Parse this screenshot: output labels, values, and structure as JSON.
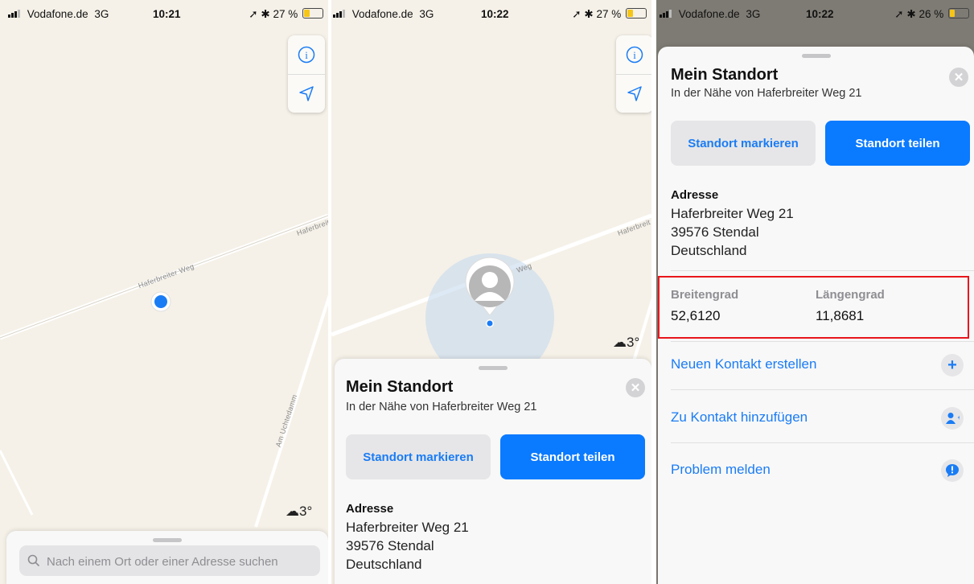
{
  "panels": [
    {
      "status": {
        "carrier": "Vodafone.de",
        "network": "3G",
        "time": "10:21",
        "battery": "27 %"
      }
    },
    {
      "status": {
        "carrier": "Vodafone.de",
        "network": "3G",
        "time": "10:22",
        "battery": "27 %"
      }
    },
    {
      "status": {
        "carrier": "Vodafone.de",
        "network": "3G",
        "time": "10:22",
        "battery": "26 %"
      }
    }
  ],
  "map": {
    "road_haferbreiter_weg": "Haferbreiter Weg",
    "road_haferbreit_cut": "Haferbreit",
    "road_am_uchtedamm": "Am Uchtedamm",
    "road_weg_fragment": "Weg",
    "weather": "3°",
    "info_icon": "info-icon",
    "location_icon": "location-arrow-icon"
  },
  "search": {
    "placeholder": "Nach einem Ort oder einer Adresse suchen"
  },
  "place_card": {
    "title": "Mein Standort",
    "subtitle": "In der Nähe von Haferbreiter Weg 21",
    "mark_button": "Standort markieren",
    "share_button": "Standort teilen",
    "address_label": "Adresse",
    "address_line1": "Haferbreiter Weg 21",
    "address_line2": "39576 Stendal",
    "address_line3": "Deutschland",
    "lat_label": "Breitengrad",
    "lat_value": "52,6120",
    "lon_label": "Längengrad",
    "lon_value": "11,8681",
    "actions": [
      {
        "label": "Neuen Kontakt erstellen",
        "icon": "plus-icon"
      },
      {
        "label": "Zu Kontakt hinzufügen",
        "icon": "add-person-icon"
      },
      {
        "label": "Problem melden",
        "icon": "exclamation-bubble-icon"
      }
    ]
  },
  "colors": {
    "accent": "#0a7aff",
    "highlight": "#e8161b",
    "map_bg": "#f5f1e8",
    "user_dot": "#1a7cf5"
  }
}
